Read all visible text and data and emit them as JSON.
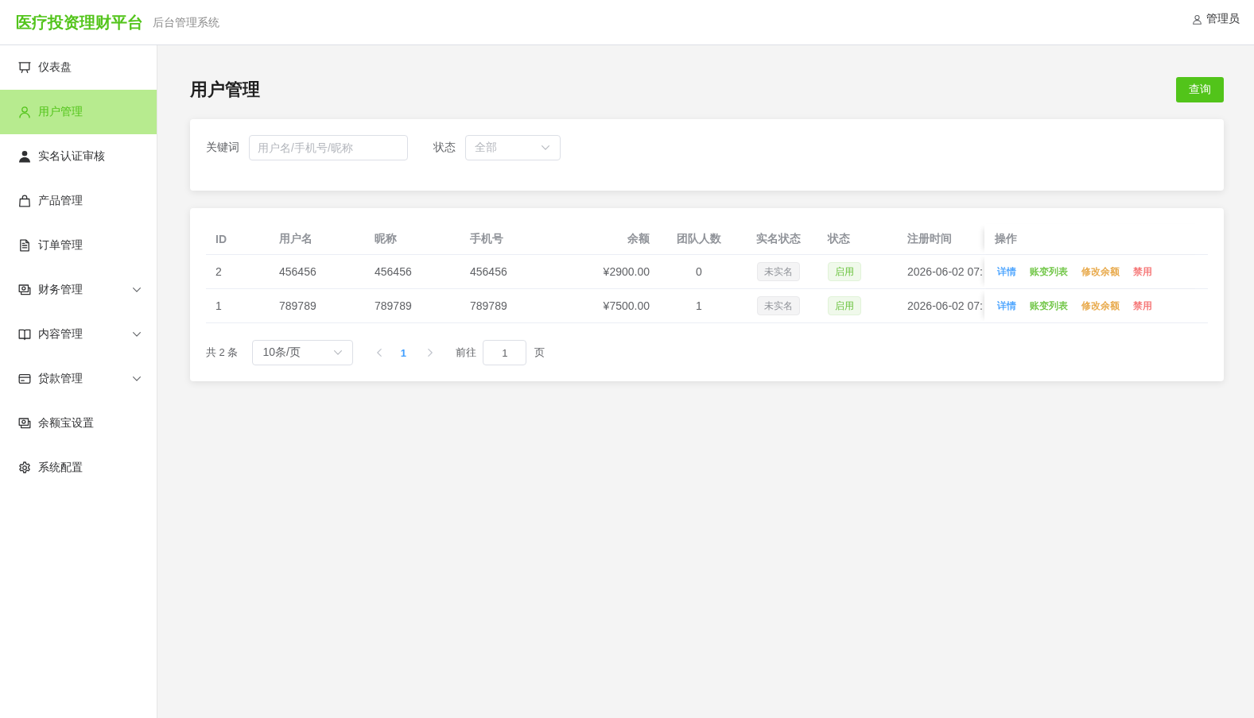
{
  "header": {
    "logo": "医疗投资理财平台",
    "subtitle": "后台管理系统",
    "user": "管理员"
  },
  "sidebar": {
    "items": [
      {
        "label": "仪表盘",
        "kind": "link",
        "selected": false
      },
      {
        "label": "用户管理",
        "kind": "link",
        "selected": true
      },
      {
        "label": "实名认证审核",
        "kind": "link",
        "selected": false
      },
      {
        "label": "产品管理",
        "kind": "link",
        "selected": false
      },
      {
        "label": "订单管理",
        "kind": "link",
        "selected": false
      },
      {
        "label": "财务管理",
        "kind": "submenu",
        "selected": false,
        "expanded": false
      },
      {
        "label": "内容管理",
        "kind": "submenu",
        "selected": false,
        "expanded": false
      },
      {
        "label": "贷款管理",
        "kind": "submenu",
        "selected": false,
        "expanded": false
      },
      {
        "label": "余额宝设置",
        "kind": "link",
        "selected": false
      },
      {
        "label": "系统配置",
        "kind": "link",
        "selected": false
      }
    ]
  },
  "page": {
    "title": "用户管理",
    "query_button": "查询"
  },
  "filters": [
    {
      "label": "关键词",
      "kind": "input",
      "placeholder": "用户名/手机号/昵称"
    },
    {
      "label": "状态",
      "kind": "select",
      "placeholder": "全部"
    }
  ],
  "table": {
    "columns": [
      {
        "label": "ID",
        "kind": "text"
      },
      {
        "label": "用户名",
        "kind": "text"
      },
      {
        "label": "昵称",
        "kind": "text"
      },
      {
        "label": "手机号",
        "kind": "text"
      },
      {
        "label": "余额",
        "kind": "text"
      },
      {
        "label": "团队人数",
        "kind": "text"
      },
      {
        "label": "实名状态",
        "kind": "tag"
      },
      {
        "label": "状态",
        "kind": "tag"
      },
      {
        "label": "注册时间",
        "kind": "text"
      },
      {
        "label": "操作",
        "kind": "actions"
      }
    ],
    "rows": [
      {
        "cells": [
          "2",
          "456456",
          "456456",
          "456456",
          "¥2900.00",
          "0",
          {
            "label": "未实名",
            "kind": "neutral"
          },
          {
            "label": "启用",
            "kind": "success"
          },
          "2026-06-02 07:",
          [
            {
              "label": "详情",
              "color": "#409eff"
            },
            {
              "label": "账变列表",
              "color": "#67c23a"
            },
            {
              "label": "修改余额",
              "color": "#e6a23c"
            },
            {
              "label": "禁用",
              "color": "#f56c6c"
            }
          ]
        ]
      },
      {
        "cells": [
          "1",
          "789789",
          "789789",
          "789789",
          "¥7500.00",
          "1",
          {
            "label": "未实名",
            "kind": "neutral"
          },
          {
            "label": "启用",
            "kind": "success"
          },
          "2026-06-02 07:",
          [
            {
              "label": "详情",
              "color": "#409eff"
            },
            {
              "label": "账变列表",
              "color": "#67c23a"
            },
            {
              "label": "修改余额",
              "color": "#e6a23c"
            },
            {
              "label": "禁用",
              "color": "#f56c6c"
            }
          ]
        ]
      }
    ]
  },
  "pagination": {
    "total": "共 2 条",
    "page_size": "10条/页",
    "prev": {
      "disabled": true
    },
    "pages": [
      {
        "label": "1",
        "selected": true
      }
    ],
    "next": {
      "disabled": true
    },
    "jump": {
      "label": "前往",
      "value": "1",
      "suffix": "页"
    }
  }
}
